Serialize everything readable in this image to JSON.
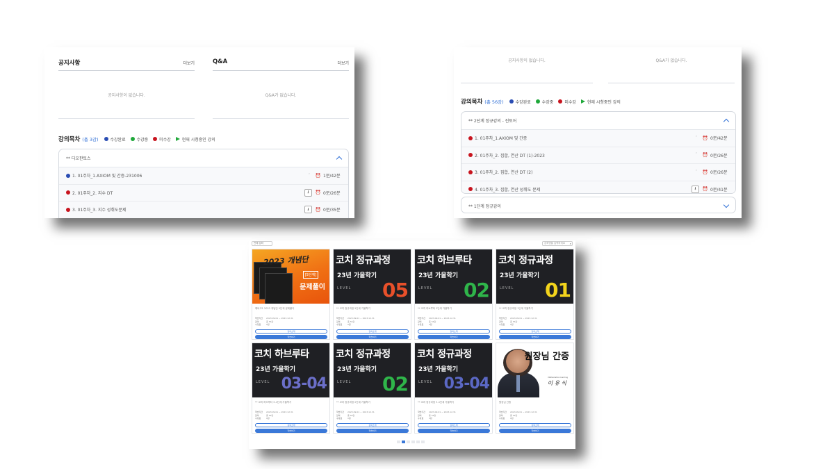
{
  "panel_a": {
    "notice": {
      "title": "공지사항",
      "more": "더보기",
      "empty": "공지사항이 없습니다."
    },
    "qna": {
      "title": "Q&A",
      "more": "더보기",
      "empty": "Q&A가 없습니다."
    },
    "toc": {
      "title": "강의목차",
      "count": "(총 3강)",
      "group": "** 디오판토스",
      "lectures": [
        {
          "name": "1. 01주차_1.AXIOM 및 간증-231006",
          "status": "completed",
          "time": "1분/42분",
          "download": false
        },
        {
          "name": "2. 01주차_2. 지수 DT",
          "status": "not_started",
          "time": "0분/26분",
          "download": true
        },
        {
          "name": "3. 01주차_3. 지수 성취도문제",
          "status": "not_started",
          "time": "0분/35분",
          "download": true
        }
      ]
    }
  },
  "legend": {
    "completed": "수강완료",
    "in_progress": "수강중",
    "not_started": "미수강",
    "playing": "현재 시청중인 강의"
  },
  "panel_b": {
    "notice_empty": "공지사항이 없습니다.",
    "qna_empty": "Q&A가 없습니다.",
    "toc": {
      "title": "강의목차",
      "count": "(총 56강)",
      "group_open": "** 2단계 정규강의 - 진토어",
      "group_closed": "** 1단계 정규강의",
      "lectures": [
        {
          "name": "1. 01주차_1.AXIOM 및 간증",
          "status": "not_started",
          "time": "0분/42분",
          "download": false
        },
        {
          "name": "2. 01주차_2. 집합, 연산 DT (1)-2023",
          "status": "not_started",
          "time": "0분/26분",
          "download": false
        },
        {
          "name": "3. 01주차_2. 집합, 연산 DT (2)",
          "status": "not_started",
          "time": "0분/26분",
          "download": false
        },
        {
          "name": "4. 01주차_3. 집합, 연산 성취도 문제",
          "status": "not_started",
          "time": "0분/41분",
          "download": true
        }
      ]
    }
  },
  "colors": {
    "completed": "#2a4db3",
    "in_progress": "#1fa83a",
    "not_started": "#c8141e",
    "playing": "#1fa83a",
    "accent": "#3a78d8"
  },
  "grid": {
    "select_label": "전체 강좌",
    "search_placeholder": "강좌명을 입력하세요",
    "cards": [
      {
        "kind": "orange",
        "title": "2023 개념단",
        "badge": "[5단계]",
        "main": "문제풀이",
        "caption": "예비고1 2023 개념단 5단계 문제풀이"
      },
      {
        "kind": "level",
        "title": "코치 정규과정",
        "sub": "23년 가을학기",
        "level": "LEVEL",
        "num": "05",
        "color": "#e8502a",
        "caption": "** 코치 정규과정 5단계 가을학기"
      },
      {
        "kind": "level",
        "title": "코치 하브루타",
        "sub": "23년 가을학기",
        "level": "LEVEL",
        "num": "02",
        "color": "#2fb54a",
        "caption": "** 코치 하브루타 2단계 가을학기"
      },
      {
        "kind": "level",
        "title": "코치 정규과정",
        "sub": "23년 가을학기",
        "level": "LEVEL",
        "num": "01",
        "color": "#f3d41c",
        "caption": "** 코치 정규과정 1단계 가을학기"
      },
      {
        "kind": "level",
        "title": "코치 하브루타",
        "sub": "23년 가을학기",
        "level": "LEVEL",
        "num": "03-04",
        "color": "#6b6fc9",
        "caption": "** 코치 하브루타 3-4단계 가을학기"
      },
      {
        "kind": "level",
        "title": "코치 정규과정",
        "sub": "23년 가을학기",
        "level": "LEVEL",
        "num": "02",
        "color": "#2fb54a",
        "caption": "** 코치 정규과정 2단계 가을학기"
      },
      {
        "kind": "level",
        "title": "코치 정규과정",
        "sub": "23년 가을학기",
        "level": "LEVEL",
        "num": "03-04",
        "color": "#5b68c4",
        "caption": "** 코치 정규과정 3-4단계 가을학기"
      },
      {
        "kind": "photo",
        "title": "원장님 간증",
        "sign": "이 유 식",
        "sign_sub": "Mathematics Coaching",
        "caption": "원장님 간증"
      }
    ],
    "card_rows": [
      {
        "label": "학습기간",
        "value": "2023.09.01 ~ 2023.12.31"
      },
      {
        "label": "강의",
        "value": "총 56강"
      },
      {
        "label": "수강료",
        "value": "0원"
      }
    ],
    "btn_detail": "강의소개",
    "btn_study": "학습하기",
    "pages": 6,
    "current_page": 2
  }
}
